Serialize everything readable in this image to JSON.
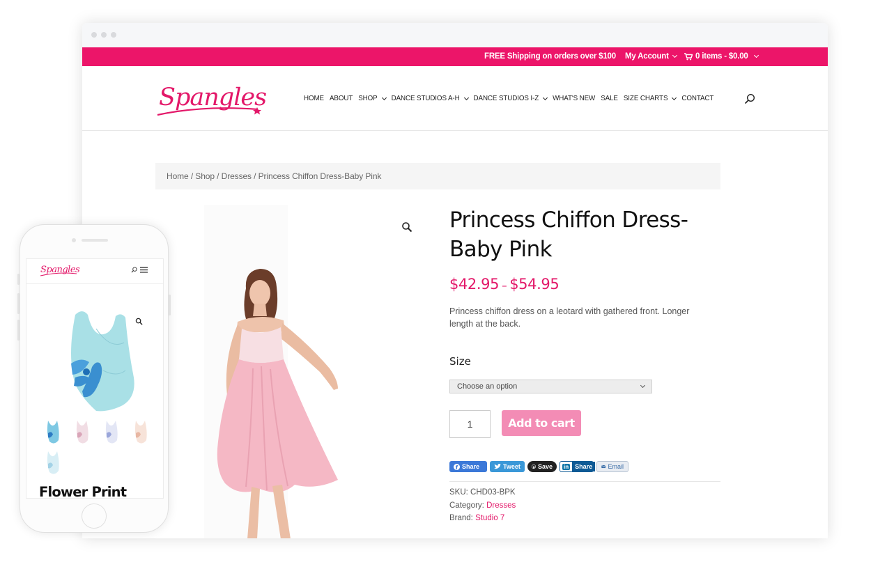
{
  "topbar": {
    "shipping": "FREE Shipping on orders over $100",
    "account": "My Account",
    "cart": "0 items - $0.00"
  },
  "brand": {
    "logo_text": "Spangles"
  },
  "nav": {
    "items": [
      {
        "label": "HOME",
        "dropdown": false
      },
      {
        "label": "ABOUT",
        "dropdown": false
      },
      {
        "label": "SHOP",
        "dropdown": true
      },
      {
        "label": "DANCE STUDIOS A-H",
        "dropdown": true
      },
      {
        "label": "DANCE STUDIOS I-Z",
        "dropdown": true
      },
      {
        "label": "WHAT'S NEW",
        "dropdown": false
      },
      {
        "label": "SALE",
        "dropdown": false
      },
      {
        "label": "SIZE CHARTS",
        "dropdown": true
      },
      {
        "label": "CONTACT",
        "dropdown": false
      }
    ]
  },
  "breadcrumb": "Home / Shop / Dresses / Princess Chiffon Dress-Baby Pink",
  "product": {
    "title": "Princess Chiffon Dress-Baby Pink",
    "price_min": "$42.95",
    "price_sep": "–",
    "price_max": "$54.95",
    "description": "Princess chiffon dress on a leotard with gathered front. Longer length at the back.",
    "size_label": "Size",
    "size_placeholder": "Choose an option",
    "quantity": "1",
    "add_to_cart": "Add to cart",
    "sku_label": "SKU:",
    "sku": "CHD03-BPK",
    "category_label": "Category:",
    "category": "Dresses",
    "brand_label": "Brand:",
    "brand": "Studio 7"
  },
  "share": {
    "facebook": "Share",
    "twitter": "Tweet",
    "pinterest": "Save",
    "linkedin": "Share",
    "email": "Email"
  },
  "mobile": {
    "logo_text": "Spangles",
    "product_title": "Flower Print"
  },
  "colors": {
    "brand_pink": "#ec1569",
    "price_pink": "#e31869",
    "button_pink": "#f38cb5"
  }
}
